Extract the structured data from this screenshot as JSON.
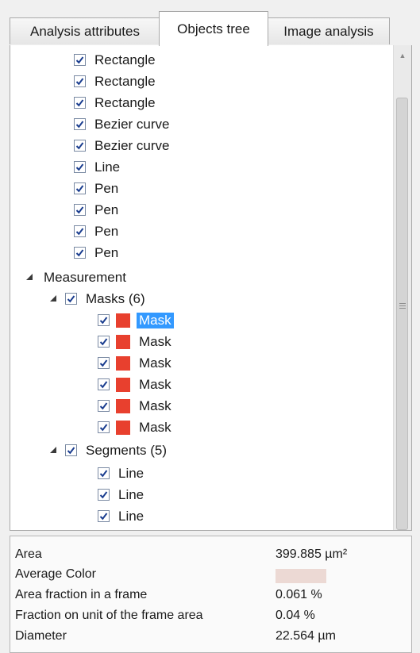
{
  "tabs": [
    {
      "label": "Analysis attributes",
      "active": false
    },
    {
      "label": "Objects tree",
      "active": true
    },
    {
      "label": "Image analysis",
      "active": false
    }
  ],
  "tree": {
    "drawing_items": [
      {
        "label": "Rectangle",
        "checked": true
      },
      {
        "label": "Rectangle",
        "checked": true
      },
      {
        "label": "Rectangle",
        "checked": true
      },
      {
        "label": "Bezier curve",
        "checked": true
      },
      {
        "label": "Bezier curve",
        "checked": true
      },
      {
        "label": "Line",
        "checked": true
      },
      {
        "label": "Pen",
        "checked": true
      },
      {
        "label": "Pen",
        "checked": true
      },
      {
        "label": "Pen",
        "checked": true
      },
      {
        "label": "Pen",
        "checked": true
      }
    ],
    "measurement": {
      "label": "Measurement",
      "masks_group": {
        "label": "Masks (6)",
        "items": [
          {
            "label": "Mask",
            "selected": true
          },
          {
            "label": "Mask",
            "selected": false
          },
          {
            "label": "Mask",
            "selected": false
          },
          {
            "label": "Mask",
            "selected": false
          },
          {
            "label": "Mask",
            "selected": false
          },
          {
            "label": "Mask",
            "selected": false
          }
        ]
      },
      "segments_group": {
        "label": "Segments (5)",
        "items": [
          {
            "label": "Line"
          },
          {
            "label": "Line"
          },
          {
            "label": "Line"
          }
        ]
      }
    }
  },
  "colors": {
    "mask_swatch": "#e8402e",
    "selection": "#3399ff",
    "average_color": "#ecd9d4"
  },
  "properties": {
    "area": {
      "name": "Area",
      "value": "399.885 µm²"
    },
    "average_color": {
      "name": "Average Color"
    },
    "area_fraction": {
      "name": "Area fraction in a frame",
      "value": "0.061 %"
    },
    "fraction_unit": {
      "name": "Fraction on unit of the frame area",
      "value": "0.04 %"
    },
    "diameter": {
      "name": "Diameter",
      "value": "22.564 µm"
    }
  }
}
